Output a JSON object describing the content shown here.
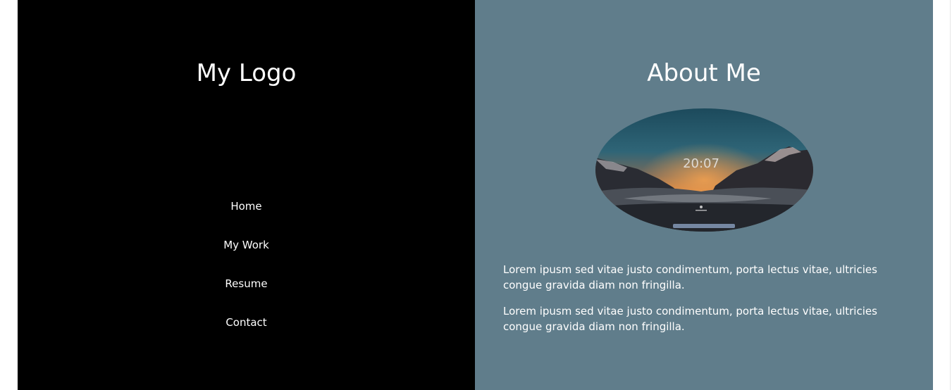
{
  "sidebar": {
    "logo": "My Logo",
    "nav": [
      {
        "label": "Home"
      },
      {
        "label": "My Work"
      },
      {
        "label": "Resume"
      },
      {
        "label": "Contact"
      }
    ]
  },
  "about": {
    "title": "About Me",
    "photo_time": "20:07",
    "paragraphs": [
      "Lorem ipusm sed vitae justo condimentum, porta lectus vitae, ultricies congue gravida diam non fringilla.",
      "Lorem ipusm sed vitae justo condimentum, porta lectus vitae, ultricies congue gravida diam non fringilla."
    ]
  },
  "colors": {
    "sidebar_bg": "#000000",
    "content_bg": "#607d8b",
    "text": "#ffffff"
  }
}
